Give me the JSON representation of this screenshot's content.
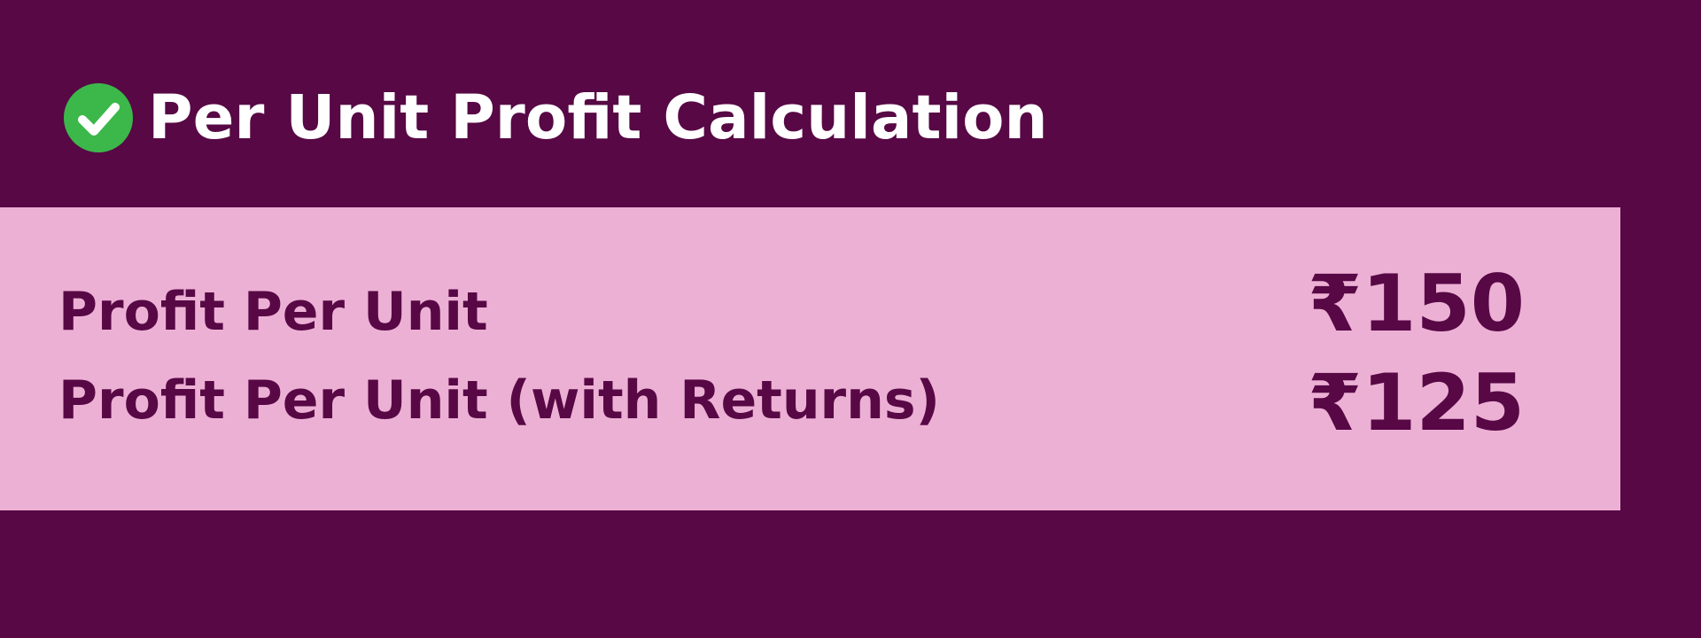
{
  "header": {
    "title": "Per Unit Profit Calculation",
    "icon": "check-circle-icon",
    "icon_color": "#3cb84a"
  },
  "rows": [
    {
      "label": "Profit Per Unit",
      "value": "₹150"
    },
    {
      "label": "Profit Per Unit (with Returns)",
      "value": "₹125"
    }
  ],
  "colors": {
    "background": "#570845",
    "panel": "#edb0d5",
    "text": "#570845"
  }
}
